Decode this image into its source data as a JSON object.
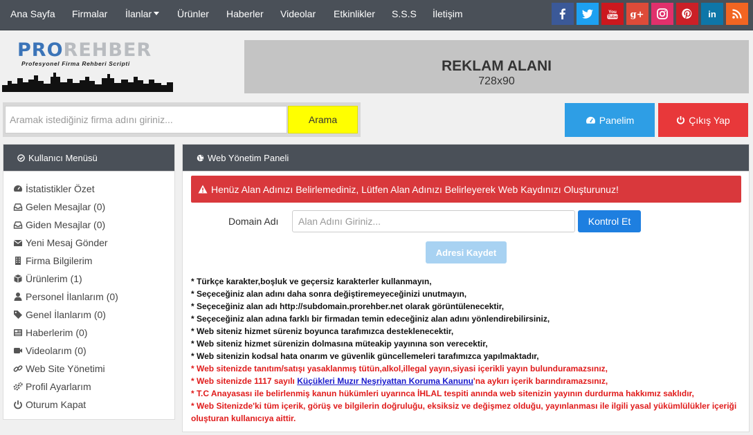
{
  "nav": {
    "items": [
      {
        "label": "Ana Sayfa"
      },
      {
        "label": "Firmalar"
      },
      {
        "label": "İlanlar"
      },
      {
        "label": "Ürünler"
      },
      {
        "label": "Haberler"
      },
      {
        "label": "Videolar"
      },
      {
        "label": "Etkinlikler"
      },
      {
        "label": "S.S.S"
      },
      {
        "label": "İletişim"
      }
    ],
    "social": [
      {
        "name": "facebook",
        "color": "#3b5998"
      },
      {
        "name": "twitter",
        "color": "#1da1f2"
      },
      {
        "name": "youtube",
        "color": "#cc181e"
      },
      {
        "name": "google-plus",
        "color": "#dd4b39"
      },
      {
        "name": "instagram",
        "color": "#e1306c"
      },
      {
        "name": "pinterest",
        "color": "#cb2027"
      },
      {
        "name": "linkedin",
        "color": "#0e76a8"
      },
      {
        "name": "rss",
        "color": "#f26522"
      }
    ]
  },
  "logo": {
    "pro": "PRO",
    "rehber": "REHBER",
    "subtitle": "Profesyonel Firma Rehberi Scripti"
  },
  "ad": {
    "title": "REKLAM ALANI",
    "size": "728x90"
  },
  "search": {
    "placeholder": "Aramak istediğiniz firma adını giriniz...",
    "button": "Arama"
  },
  "account": {
    "panel": "Panelim",
    "logout": "Çıkış Yap"
  },
  "sidebar": {
    "title": "Kullanıcı Menüsü",
    "items": [
      {
        "label": "İstatistikler Özet",
        "icon": "dashboard-icon"
      },
      {
        "label": "Gelen Mesajlar (0)",
        "icon": "inbox-icon"
      },
      {
        "label": "Giden Mesajlar (0)",
        "icon": "inbox-icon"
      },
      {
        "label": "Yeni Mesaj Gönder",
        "icon": "envelope-icon"
      },
      {
        "label": "Firma Bilgilerim",
        "icon": "building-icon"
      },
      {
        "label": "Ürünlerim (1)",
        "icon": "cube-icon"
      },
      {
        "label": "Personel İlanlarım (0)",
        "icon": "user-icon"
      },
      {
        "label": "Genel İlanlarım (0)",
        "icon": "tag-icon"
      },
      {
        "label": "Haberlerim (0)",
        "icon": "newspaper-icon"
      },
      {
        "label": "Videolarım (0)",
        "icon": "video-icon"
      },
      {
        "label": "Web Site Yönetimi",
        "icon": "link-icon"
      },
      {
        "label": "Profil Ayarlarım",
        "icon": "gears-icon"
      },
      {
        "label": "Oturum Kapat",
        "icon": "power-icon"
      }
    ]
  },
  "main": {
    "title": "Web Yönetim Paneli",
    "alert": "Henüz Alan Adınızı Belirlemediniz, Lütfen Alan Adınızı Belirleyerek Web Kaydınızı Oluşturunuz!",
    "domain_label": "Domain Adı",
    "domain_placeholder": "Alan Adını Giriniz...",
    "check_button": "Kontrol Et",
    "save_button": "Adresi Kaydet",
    "rules": [
      {
        "text": "* Türkçe karakter,boşluk ve geçersiz karakterler kullanmayın,",
        "color": "black"
      },
      {
        "text": "* Seçeceğiniz alan adını daha sonra değiştiremeyeceğinizi unutmayın,",
        "color": "black"
      },
      {
        "text": "* Seçeceğiniz alan adı http://subdomain.prorehber.net olarak görüntülenecektir,",
        "color": "black"
      },
      {
        "text": "* Seçeceğiniz alan adına farklı bir firmadan temin edeceğiniz alan adını yönlendirebilirsiniz,",
        "color": "black"
      },
      {
        "text": "* Web siteniz hizmet süreniz boyunca tarafımızca desteklenecektir,",
        "color": "black"
      },
      {
        "text": "* Web siteniz hizmet sürenizin dolmasına müteakip yayınına son verecektir,",
        "color": "black"
      },
      {
        "text": "* Web sitenizin kodsal hata onarım ve güvenlik güncellemeleri tarafımızca yapılmaktadır,",
        "color": "black"
      },
      {
        "text": "* Web sitenizde tanıtım/satışı yasaklanmış tütün,alkol,illegal yayın,siyasi içerikli yayın bulunduramazsınız,",
        "color": "red"
      },
      {
        "text": "* T.C Anayasası ile belirlenmiş kanun hükümleri uyarınca İHLAL tespiti anında web sitenizin yayının durdurma hakkımız saklıdır,",
        "color": "red"
      },
      {
        "text": "* Web Sitenizde'ki tüm içerik, görüş ve bilgilerin doğruluğu, eksiksiz ve değişmez olduğu, yayınlanması ile ilgili yasal yükümlülükler içeriği oluşturan kullanıcıya aittir.",
        "color": "red"
      }
    ],
    "law_rule": {
      "before": "* Web sitenizde 1117 sayılı ",
      "link": "Küçükleri Muzır Neşriyattan Koruma Kanunu",
      "after": "'na aykırı içerik barındıramazsınız,"
    }
  }
}
